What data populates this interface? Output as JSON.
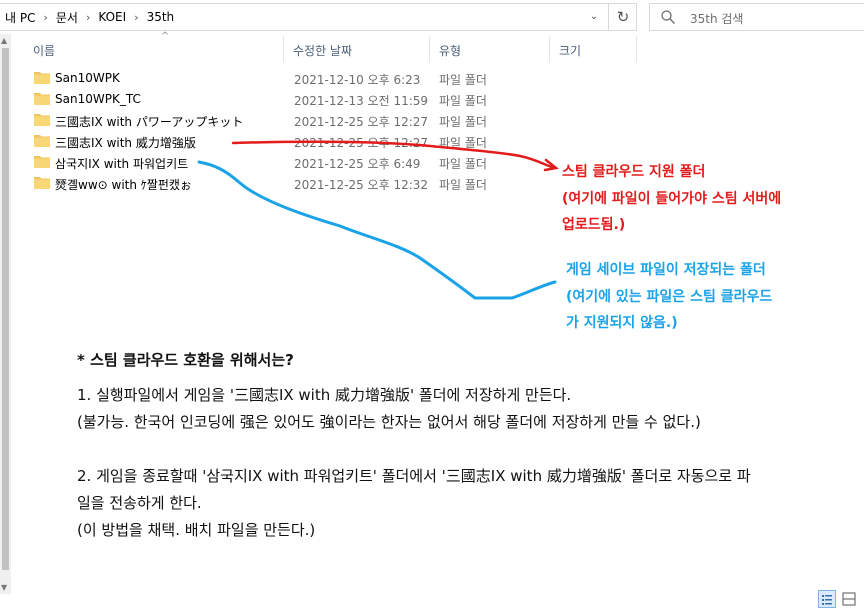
{
  "breadcrumb": [
    "내 PC",
    "문서",
    "KOEI",
    "35th"
  ],
  "search": {
    "placeholder": "35th 검색"
  },
  "columns": {
    "name": "이름",
    "modified": "수정한 날짜",
    "type": "유형",
    "size": "크기"
  },
  "files": [
    {
      "name": "San10WPK",
      "modified": "2021-12-10 오후 6:23",
      "type": "파일 폴더"
    },
    {
      "name": "San10WPK_TC",
      "modified": "2021-12-13 오전 11:59",
      "type": "파일 폴더"
    },
    {
      "name": "三國志IX with パワーアップキット",
      "modified": "2021-12-25 오후 12:27",
      "type": "파일 폴더"
    },
    {
      "name": "三國志IX with 威力增強版",
      "modified": "2021-12-25 오후 12:27",
      "type": "파일 폴더"
    },
    {
      "name": "삼국지IX with 파워업키트",
      "modified": "2021-12-25 오후 6:49",
      "type": "파일 폴더"
    },
    {
      "name": "燹곌ww⊙ with ｹ짤펀캤ぉ",
      "modified": "2021-12-25 오후 12:32",
      "type": "파일 폴더"
    }
  ],
  "annotations": {
    "red": [
      "스팀 클라우드 지원 폴더",
      "(여기에 파일이 들어가야 스팀 서버에",
      "업로드됨.)"
    ],
    "blue": [
      "게임 세이브 파일이 저장되는 폴더",
      "(여기에 있는 파일은 스팀 클라우드",
      "가 지원되지 않음.)"
    ],
    "red_color": "#e41b1b",
    "blue_color": "#1aa3e8"
  },
  "notes": {
    "heading": "* 스팀 클라우드 호환을 위해서는?",
    "line1": "1. 실행파일에서 게임을 '三國志IX with 威力增強版' 폴더에 저장하게 만든다.",
    "line2": "(불가능. 한국어 인코딩에 强은 있어도 強이라는 한자는 없어서 해당 폴더에 저장하게 만들 수 없다.)",
    "line3": "2. 게임을 종료할때 '삼국지IX with 파워업키트' 폴더에서 '三國志IX with 威力增強版' 폴더로 자동으로 파",
    "line4": "일을 전송하게 한다.",
    "line5": "(이 방법을 채택. 배치 파일을 만든다.)"
  },
  "icons": {
    "folder_color": "#f2c55c",
    "refresh": "refresh-icon",
    "search": "search-icon"
  }
}
